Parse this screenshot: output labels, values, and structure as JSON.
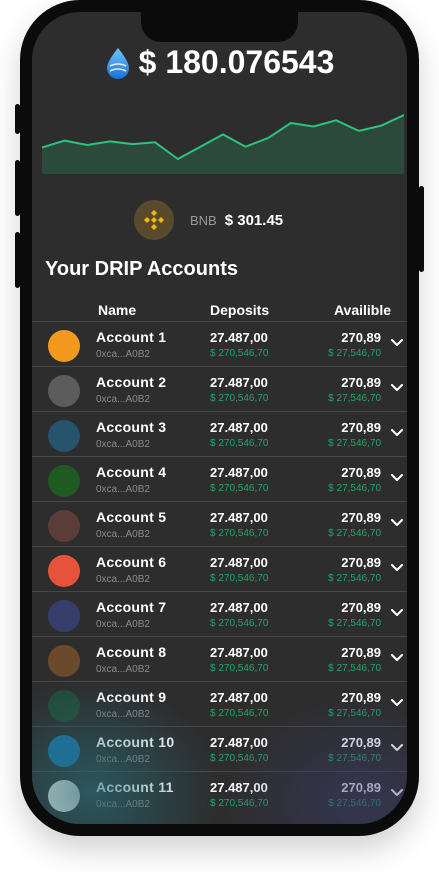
{
  "balance": {
    "amount": "$ 180.076543",
    "icon": "drip-drop-icon"
  },
  "chart_data": {
    "type": "area",
    "x": [
      0,
      1,
      2,
      3,
      4,
      5,
      6,
      7,
      8,
      9,
      10,
      11,
      12,
      13,
      14,
      15,
      16
    ],
    "values": [
      30,
      38,
      33,
      37,
      34,
      36,
      17,
      31,
      45,
      31,
      41,
      58,
      54,
      61,
      49,
      55,
      67
    ],
    "ylim": [
      0,
      100
    ],
    "line_color": "#2ec27e",
    "fill_color": "#2b4a3c"
  },
  "bnb": {
    "label": "BNB",
    "price": "$ 301.45",
    "icon": "bnb-icon",
    "color": "#f0b90b"
  },
  "section_title": "Your DRIP Accounts",
  "columns": {
    "name": "Name",
    "deposits": "Deposits",
    "available": "Availible"
  },
  "accounts": [
    {
      "name": "Account 1",
      "addr": "0xca...A0B2",
      "deposit": "27.487,00",
      "deposit_usd": "$ 270,546,70",
      "avail": "270,89",
      "avail_usd": "$ 27,546,70",
      "color": "#f39a1e"
    },
    {
      "name": "Account 2",
      "addr": "0xca...A0B2",
      "deposit": "27.487,00",
      "deposit_usd": "$ 270,546,70",
      "avail": "270,89",
      "avail_usd": "$ 27,546,70",
      "color": "#5c5c5d"
    },
    {
      "name": "Account 3",
      "addr": "0xca...A0B2",
      "deposit": "27.487,00",
      "deposit_usd": "$ 270,546,70",
      "avail": "270,89",
      "avail_usd": "$ 27,546,70",
      "color": "#25536b"
    },
    {
      "name": "Account 4",
      "addr": "0xca...A0B2",
      "deposit": "27.487,00",
      "deposit_usd": "$ 270,546,70",
      "avail": "270,89",
      "avail_usd": "$ 27,546,70",
      "color": "#1e5a22"
    },
    {
      "name": "Account 5",
      "addr": "0xca...A0B2",
      "deposit": "27.487,00",
      "deposit_usd": "$ 270,546,70",
      "avail": "270,89",
      "avail_usd": "$ 27,546,70",
      "color": "#5a3d38"
    },
    {
      "name": "Account 6",
      "addr": "0xca...A0B2",
      "deposit": "27.487,00",
      "deposit_usd": "$ 270,546,70",
      "avail": "270,89",
      "avail_usd": "$ 27,546,70",
      "color": "#e5533a"
    },
    {
      "name": "Account 7",
      "addr": "0xca...A0B2",
      "deposit": "27.487,00",
      "deposit_usd": "$ 270,546,70",
      "avail": "270,89",
      "avail_usd": "$ 27,546,70",
      "color": "#363f6b"
    },
    {
      "name": "Account 8",
      "addr": "0xca...A0B2",
      "deposit": "27.487,00",
      "deposit_usd": "$ 270,546,70",
      "avail": "270,89",
      "avail_usd": "$ 27,546,70",
      "color": "#6b4a2b"
    },
    {
      "name": "Account 9",
      "addr": "0xca...A0B2",
      "deposit": "27.487,00",
      "deposit_usd": "$ 270,546,70",
      "avail": "270,89",
      "avail_usd": "$ 27,546,70",
      "color": "#234a36"
    },
    {
      "name": "Account 10",
      "addr": "0xca...A0B2",
      "deposit": "27.487,00",
      "deposit_usd": "$ 270,546,70",
      "avail": "270,89",
      "avail_usd": "$ 27,546,70",
      "color": "#1b6fa3"
    },
    {
      "name": "Account 11",
      "addr": "0xca...A0B2",
      "deposit": "27.487,00",
      "deposit_usd": "$ 270,546,70",
      "avail": "270,89",
      "avail_usd": "$ 27,546,70",
      "color": "#dcdcdc"
    }
  ]
}
